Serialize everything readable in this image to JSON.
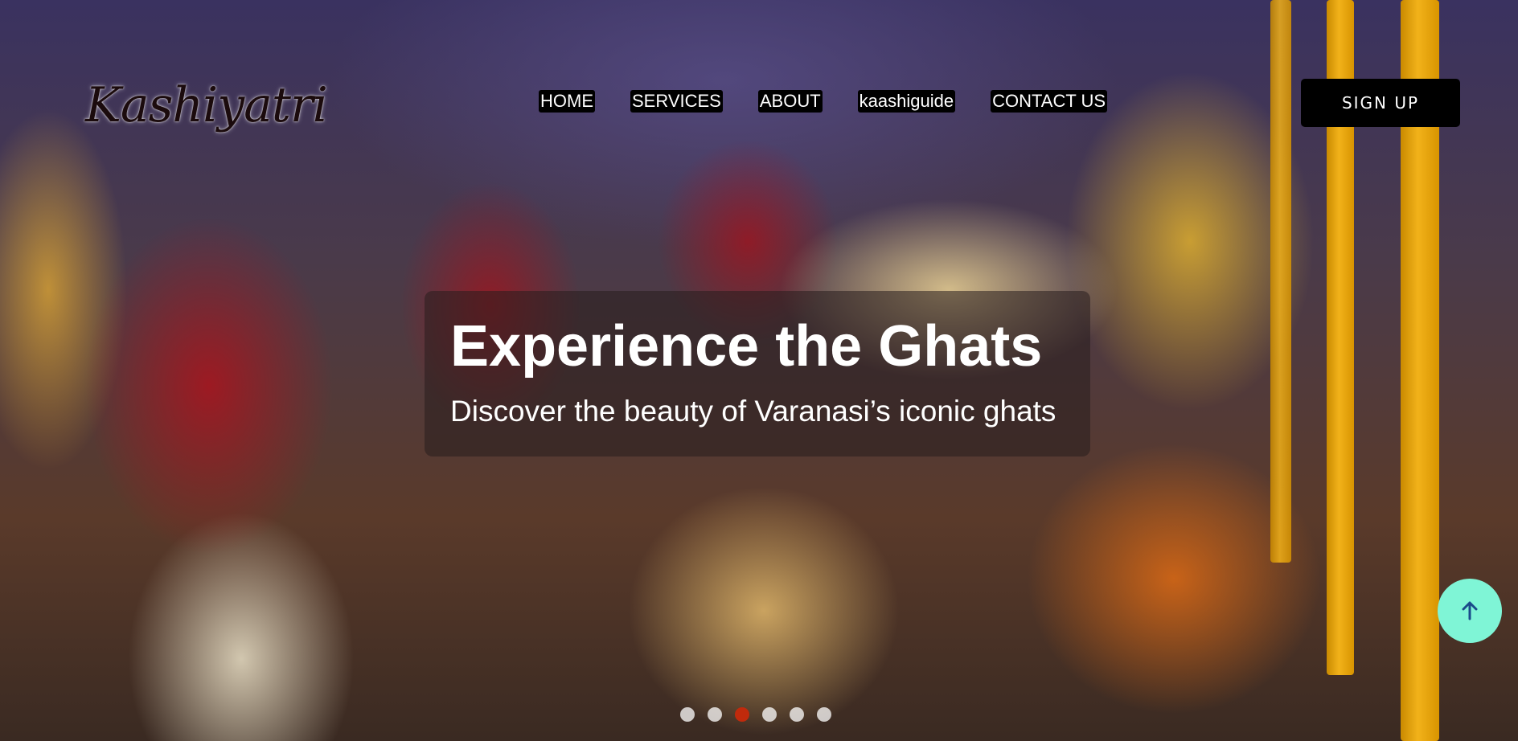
{
  "brand": {
    "logo_text": "Kashiyatri"
  },
  "nav": {
    "items": [
      {
        "label": "HOME"
      },
      {
        "label": "SERVICES"
      },
      {
        "label": "ABOUT"
      },
      {
        "label": "kaashiguide"
      },
      {
        "label": "CONTACT US"
      }
    ],
    "signup_label": "SIGN UP"
  },
  "hero": {
    "title": "Experience the Ghats",
    "subtitle": "Discover the beauty of Varanasi’s iconic ghats",
    "slides_count": 6,
    "active_slide": 3
  },
  "colors": {
    "nav_bg": "#000000",
    "signup_bg": "#000000",
    "active_dot": "#c02a0c",
    "scroll_top_bg": "#7ff5d6",
    "scroll_top_arrow": "#1a4a8a"
  },
  "icons": {
    "scroll_top": "arrow-up-icon"
  }
}
